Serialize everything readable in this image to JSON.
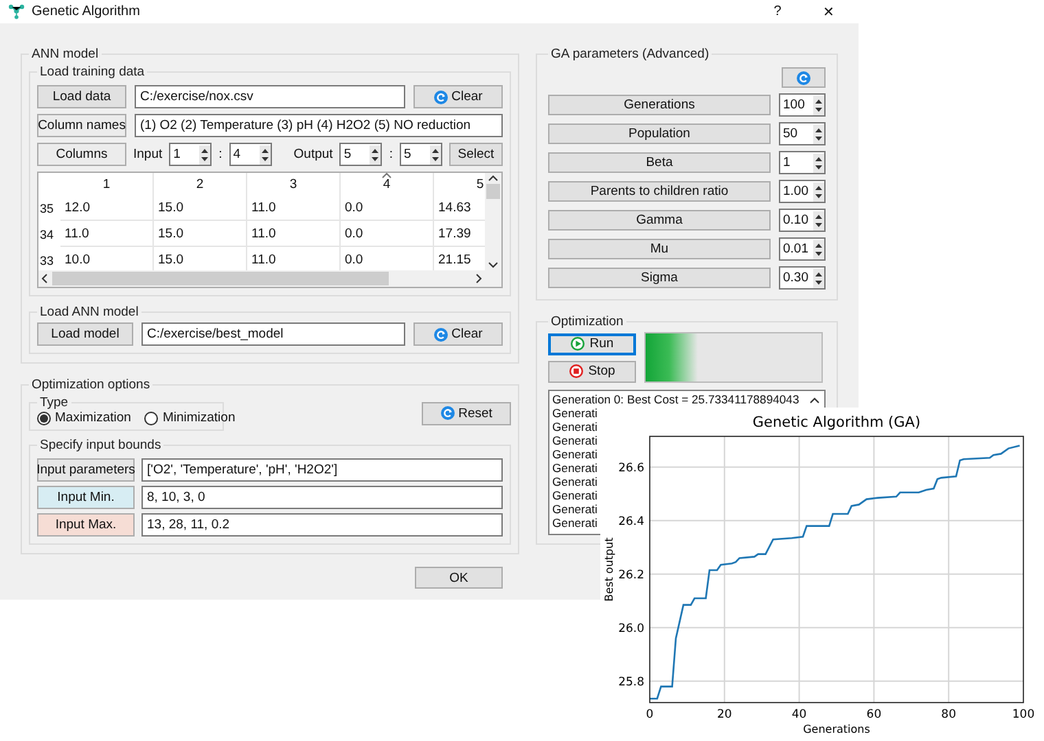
{
  "window": {
    "title": "Genetic Algorithm",
    "help": "?",
    "close": "✕"
  },
  "ann_model": {
    "title": "ANN model",
    "training": {
      "title": "Load training data",
      "load_button": "Load data",
      "path": "C:/exercise/nox.csv",
      "clear_button": "Clear",
      "names_button": "Column names",
      "names": "(1) O2 (2) Temperature (3) pH (4) H2O2 (5) NO reduction",
      "columns_button": "Columns",
      "input_label": "Input",
      "input_from": "1",
      "input_sep": ":",
      "input_to": "4",
      "output_label": "Output",
      "output_from": "5",
      "output_sep": ":",
      "output_to": "5",
      "select_button": "Select",
      "table": {
        "columns": [
          {
            "label": "1",
            "sorted": false
          },
          {
            "label": "2",
            "sorted": false
          },
          {
            "label": "3",
            "sorted": false
          },
          {
            "label": "4",
            "sorted": true
          },
          {
            "label": "5",
            "sorted": false
          }
        ],
        "rows": [
          {
            "header": "35",
            "cells": [
              "12.0",
              "15.0",
              "11.0",
              "0.0",
              "14.63"
            ]
          },
          {
            "header": "34",
            "cells": [
              "11.0",
              "15.0",
              "11.0",
              "0.0",
              "17.39"
            ]
          },
          {
            "header": "33",
            "cells": [
              "10.0",
              "15.0",
              "11.0",
              "0.0",
              "21.15"
            ]
          }
        ]
      }
    },
    "model": {
      "title": "Load ANN model",
      "load_button": "Load model",
      "path": "C:/exercise/best_model",
      "clear_button": "Clear"
    }
  },
  "optimization_options": {
    "title": "Optimization options",
    "type": {
      "title": "Type",
      "options": [
        {
          "label": "Maximization",
          "selected": true
        },
        {
          "label": "Minimization",
          "selected": false
        }
      ]
    },
    "reset_button": "Reset",
    "bounds": {
      "title": "Specify input bounds",
      "rows": [
        {
          "label": "Input parameters",
          "value": "['O2', 'Temperature', 'pH', 'H2O2']",
          "color": "#e6e6e6"
        },
        {
          "label": "Input Min.",
          "value": "8, 10, 3, 0",
          "color": "#d7edf3"
        },
        {
          "label": "Input Max.",
          "value": "13, 28, 11, 0.2",
          "color": "#f6ddd5"
        }
      ]
    }
  },
  "ok_button": "OK",
  "ga_parameters": {
    "title": "GA parameters (Advanced)",
    "params": [
      {
        "label": "Generations",
        "value": "100"
      },
      {
        "label": "Population",
        "value": "50"
      },
      {
        "label": "Beta",
        "value": "1"
      },
      {
        "label": "Parents to children ratio",
        "value": "1.00"
      },
      {
        "label": "Gamma",
        "value": "0.10"
      },
      {
        "label": "Mu",
        "value": "0.01"
      },
      {
        "label": "Sigma",
        "value": "0.30"
      }
    ]
  },
  "optimization": {
    "title": "Optimization",
    "run_button": "Run",
    "stop_button": "Stop",
    "progress": {
      "level": 0.3
    },
    "log": [
      "Generation 0: Best Cost = 25.73341178894043",
      "Generati",
      "Generati",
      "Generati",
      "Generati",
      "Generati",
      "Generati",
      "Generati",
      "Generati",
      "Generati"
    ]
  },
  "plot": {
    "chart_data": {
      "type": "line",
      "title": "Genetic Algorithm (GA)",
      "xlabel": "Generations",
      "ylabel": "Best output",
      "x": [
        0,
        2,
        3,
        6,
        7,
        9,
        11,
        12,
        15,
        16,
        18,
        19,
        22,
        23,
        24,
        28,
        29,
        31,
        33,
        38,
        41,
        42,
        48,
        49,
        53,
        54,
        56,
        58,
        61,
        66,
        67,
        72,
        74,
        76,
        77,
        78,
        82,
        83,
        84,
        91,
        92,
        94,
        96,
        99
      ],
      "grid": true,
      "series": [
        {
          "color": "#1f77b4",
          "values": [
            25.735,
            25.735,
            25.78,
            25.78,
            25.96,
            26.085,
            26.085,
            26.11,
            26.11,
            26.215,
            26.215,
            26.235,
            26.24,
            26.245,
            26.26,
            26.265,
            26.275,
            26.275,
            26.33,
            26.335,
            26.34,
            26.38,
            26.38,
            26.425,
            26.425,
            26.455,
            26.46,
            26.48,
            26.485,
            26.49,
            26.505,
            26.505,
            26.515,
            26.52,
            26.555,
            26.56,
            26.565,
            26.625,
            26.63,
            26.635,
            26.645,
            26.65,
            26.67,
            26.68
          ]
        }
      ],
      "xlim": [
        0,
        100
      ],
      "ylim": [
        25.72,
        26.715
      ],
      "xticks": [
        0,
        20,
        40,
        60,
        80,
        100
      ],
      "yticks": [
        {
          "value": 25.8,
          "label": "25.8"
        },
        {
          "value": 26.0,
          "label": "26.0"
        },
        {
          "value": 26.2,
          "label": "26.2"
        },
        {
          "value": 26.4,
          "label": "26.4"
        },
        {
          "value": 26.6,
          "label": "26.6"
        }
      ]
    }
  }
}
